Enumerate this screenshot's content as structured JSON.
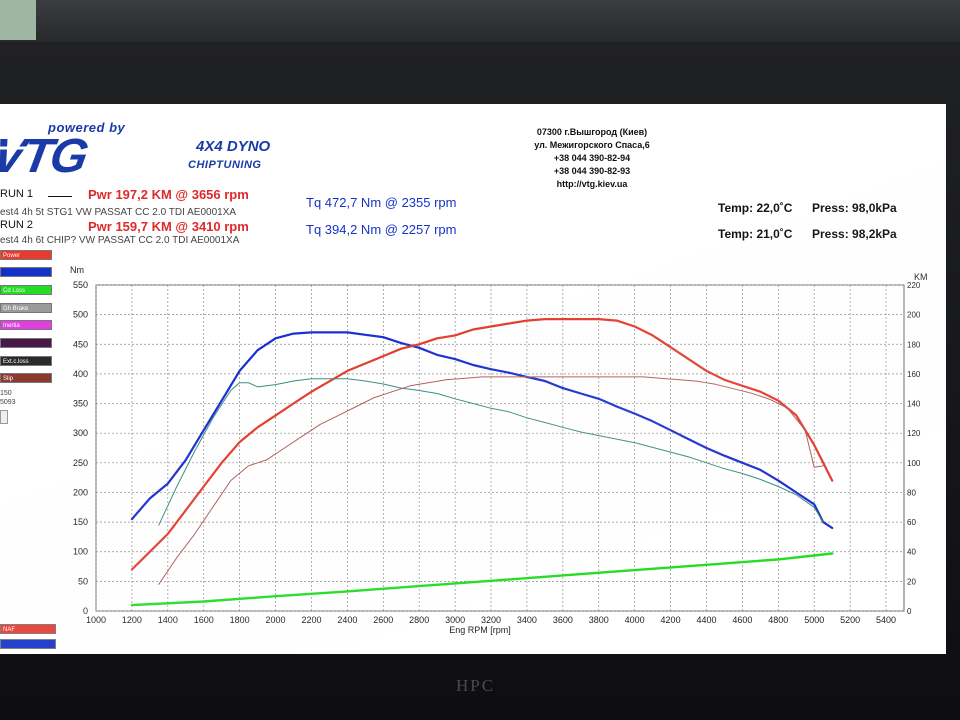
{
  "header": {
    "tagline": "powered by",
    "logo_text": "VTG",
    "dyno_title": "4X4 DYNO",
    "chiptuning": "CHIPTUNING",
    "contact": [
      "07300 г.Вышгород (Киев)",
      "ул. Межигорского Спаса,6",
      "+38 044 390-82-94",
      "+38 044 390-82-93",
      "http://vtg.kiev.ua"
    ]
  },
  "runs": [
    {
      "label": "RUN 1",
      "pwr": "Pwr  197,2 KM @ 3656 rpm",
      "tq": "Tq 472,7 Nm @ 2355 rpm",
      "desc": "est4  4h 5t  STG1 VW PASSAT CC 2.0 TDI AE0001XA",
      "temp": "Temp: 22,0˚C",
      "press": "Press: 98,0kPa"
    },
    {
      "label": "RUN 2",
      "pwr": "Pwr  159,7 KM @ 3410 rpm",
      "tq": "Tq 394,2 Nm @ 2257 rpm",
      "desc": "est4  4h 6t  CHIP? VW PASSAT CC 2.0 TDI AE0001XA",
      "temp": "Temp: 21,0˚C",
      "press": "Press: 98,2kPa"
    }
  ],
  "legend": [
    {
      "label": "Power",
      "color": "#e83a2e"
    },
    {
      "label": "",
      "color": "#1533c8"
    },
    {
      "label": "Cd Loss",
      "color": "#22dd22"
    },
    {
      "label": "Gh Brake",
      "color": "#9a9a9a"
    },
    {
      "label": "Inertia",
      "color": "#e040e0"
    },
    {
      "label": "",
      "color": "#4a1848"
    },
    {
      "label": "Ext.c.loss",
      "color": "#2a2a2a"
    },
    {
      "label": "Slip",
      "color": "#8a3a30"
    }
  ],
  "side_values": [
    "150",
    "5093"
  ],
  "bottom_legend": [
    {
      "label": "NAF",
      "color": "#e83a2e"
    },
    {
      "label": "",
      "color": "#1533c8"
    }
  ],
  "chart_data": {
    "type": "line",
    "xlabel": "Eng RPM [rpm]",
    "ylabel_left": "Nm",
    "ylabel_right": "KM",
    "x_ticks": [
      1000,
      1200,
      1400,
      1600,
      1800,
      2000,
      2200,
      2400,
      2600,
      2800,
      3000,
      3200,
      3400,
      3600,
      3800,
      4000,
      4200,
      4400,
      4600,
      4800,
      5000,
      5200,
      5400
    ],
    "y_left_ticks": [
      0,
      50,
      100,
      150,
      200,
      250,
      300,
      350,
      400,
      450,
      500,
      550
    ],
    "y_right_ticks": [
      0,
      20,
      40,
      60,
      80,
      100,
      120,
      140,
      160,
      180,
      200,
      220
    ],
    "xlim": [
      1000,
      5500
    ],
    "ylim_left": [
      0,
      550
    ],
    "ylim_right": [
      0,
      220
    ],
    "grid": true,
    "series": [
      {
        "axis": "left",
        "color": "#1a2fd0",
        "width": 2.2,
        "x": [
          1200,
          1300,
          1400,
          1500,
          1600,
          1700,
          1800,
          1900,
          2000,
          2100,
          2200,
          2300,
          2400,
          2500,
          2600,
          2700,
          2800,
          2900,
          3000,
          3100,
          3200,
          3300,
          3400,
          3500,
          3600,
          3700,
          3800,
          3900,
          4000,
          4100,
          4200,
          4300,
          4400,
          4500,
          4600,
          4700,
          4800,
          4900,
          5000,
          5050,
          5100
        ],
        "y": [
          155,
          190,
          215,
          255,
          305,
          355,
          405,
          440,
          460,
          468,
          470,
          470,
          470,
          466,
          462,
          452,
          444,
          432,
          425,
          415,
          408,
          402,
          395,
          388,
          376,
          367,
          358,
          345,
          333,
          320,
          305,
          290,
          275,
          262,
          250,
          238,
          220,
          200,
          180,
          150,
          140
        ]
      },
      {
        "axis": "right",
        "color": "#e33b2c",
        "width": 2.2,
        "x": [
          1200,
          1300,
          1400,
          1500,
          1600,
          1700,
          1800,
          1900,
          2000,
          2100,
          2200,
          2300,
          2400,
          2500,
          2600,
          2700,
          2800,
          2900,
          3000,
          3100,
          3200,
          3300,
          3400,
          3500,
          3600,
          3700,
          3800,
          3900,
          4000,
          4100,
          4200,
          4300,
          4400,
          4500,
          4600,
          4700,
          4800,
          4900,
          5000,
          5050,
          5100
        ],
        "y": [
          28,
          40,
          52,
          68,
          84,
          100,
          114,
          124,
          132,
          140,
          148,
          155,
          162,
          167,
          172,
          177,
          180,
          184,
          186,
          190,
          192,
          194,
          196,
          197,
          197,
          197,
          197,
          196,
          192,
          186,
          178,
          170,
          162,
          156,
          152,
          148,
          142,
          132,
          112,
          100,
          88
        ]
      },
      {
        "axis": "left",
        "color": "#3a8a80",
        "width": 1,
        "x": [
          1350,
          1450,
          1550,
          1650,
          1750,
          1800,
          1850,
          1900,
          2000,
          2100,
          2200,
          2300,
          2400,
          2500,
          2600,
          2700,
          2800,
          2900,
          3000,
          3100,
          3200,
          3300,
          3400,
          3500,
          3600,
          3700,
          3800,
          3900,
          4000,
          4100,
          4200,
          4300,
          4400,
          4500,
          4600,
          4700,
          4800,
          4900,
          5000,
          5050
        ],
        "y": [
          145,
          210,
          270,
          325,
          372,
          385,
          385,
          378,
          382,
          388,
          392,
          392,
          392,
          388,
          383,
          376,
          372,
          367,
          358,
          350,
          342,
          336,
          326,
          318,
          310,
          302,
          296,
          290,
          284,
          276,
          268,
          260,
          250,
          240,
          232,
          222,
          210,
          196,
          175,
          150
        ]
      },
      {
        "axis": "right",
        "color": "#b25a58",
        "width": 1,
        "x": [
          1350,
          1450,
          1550,
          1650,
          1750,
          1850,
          1950,
          2050,
          2150,
          2250,
          2350,
          2450,
          2550,
          2650,
          2750,
          2850,
          2950,
          3050,
          3150,
          3250,
          3350,
          3450,
          3550,
          3650,
          3750,
          3850,
          3950,
          4050,
          4150,
          4250,
          4350,
          4450,
          4550,
          4650,
          4750,
          4850,
          4950,
          5000,
          5050
        ],
        "y": [
          18,
          36,
          52,
          70,
          88,
          98,
          102,
          110,
          118,
          126,
          132,
          138,
          144,
          148,
          152,
          154,
          156,
          157,
          158,
          158,
          158,
          158,
          158,
          158,
          158,
          158,
          158,
          158,
          157,
          156,
          155,
          153,
          150,
          147,
          143,
          137,
          122,
          97,
          98
        ]
      },
      {
        "axis": "left",
        "color": "#22dd22",
        "width": 2.4,
        "x": [
          1200,
          1600,
          2000,
          2400,
          2800,
          3200,
          3600,
          4000,
          4400,
          4800,
          5100
        ],
        "y": [
          10,
          16,
          25,
          33,
          42,
          51,
          60,
          69,
          78,
          87,
          97
        ]
      }
    ]
  }
}
